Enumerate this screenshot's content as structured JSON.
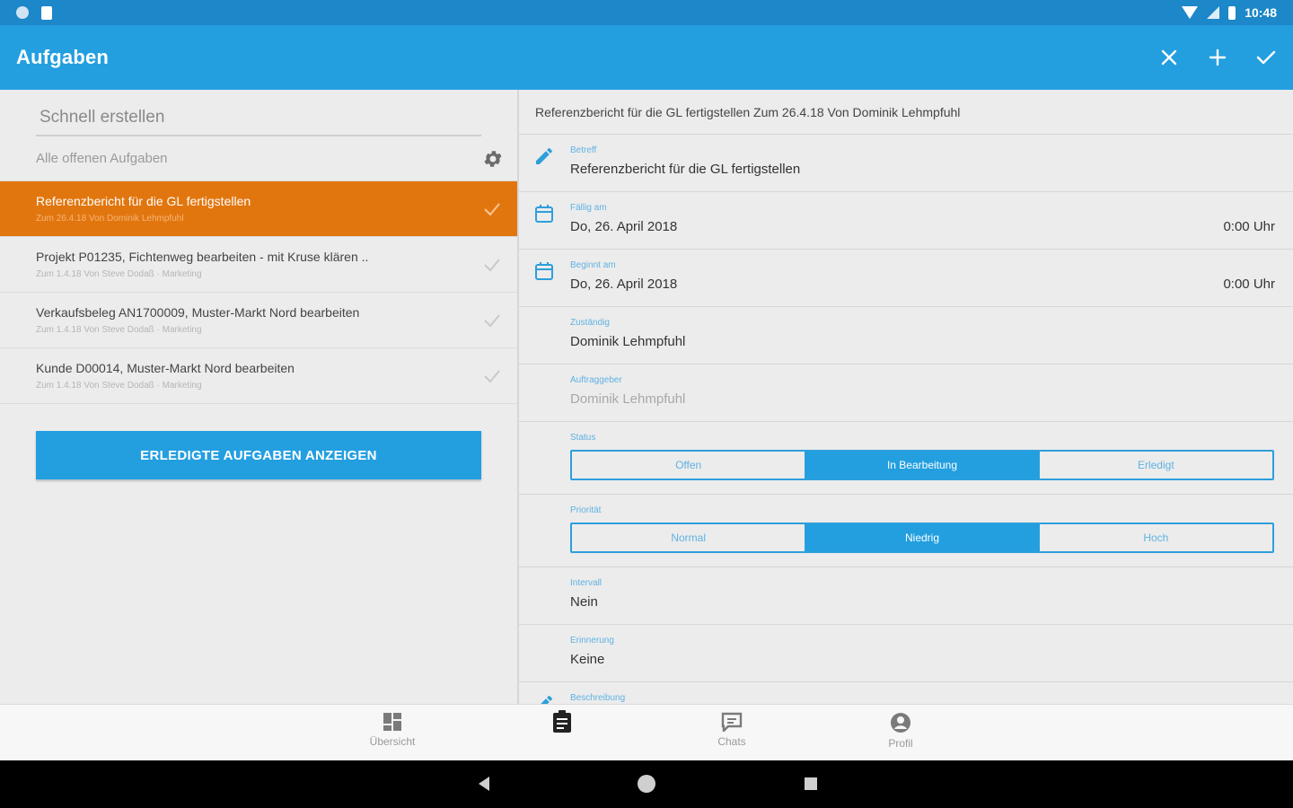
{
  "status_bar": {
    "time": "10:48"
  },
  "app_bar": {
    "title": "Aufgaben",
    "actions": [
      "close-icon",
      "add-icon",
      "check-icon"
    ]
  },
  "left": {
    "quick_create_placeholder": "Schnell erstellen",
    "filter_label": "Alle offenen Aufgaben",
    "tasks": [
      {
        "title": "Referenzbericht für die GL fertigstellen",
        "meta": "Zum 26.4.18 Von Dominik Lehmpfuhl",
        "active": true
      },
      {
        "title": "Projekt P01235, Fichtenweg bearbeiten - mit Kruse klären ..",
        "meta": "Zum 1.4.18 Von Steve Dodaß · Marketing",
        "active": false
      },
      {
        "title": "Verkaufsbeleg AN1700009, Muster-Markt Nord bearbeiten",
        "meta": "Zum 1.4.18 Von Steve Dodaß · Marketing",
        "active": false
      },
      {
        "title": "Kunde D00014, Muster-Markt Nord bearbeiten",
        "meta": "Zum 1.4.18 Von Steve Dodaß · Marketing",
        "active": false
      }
    ],
    "done_button": "ERLEDIGTE AUFGABEN ANZEIGEN"
  },
  "detail": {
    "header": "Referenzbericht für die GL fertigstellen   Zum 26.4.18 Von Dominik Lehmpfuhl",
    "betreff": {
      "label": "Betreff",
      "value": "Referenzbericht für die GL fertigstellen"
    },
    "faellig": {
      "label": "Fällig am",
      "date": "Do, 26. April 2018",
      "time": "0:00 Uhr"
    },
    "beginnt": {
      "label": "Beginnt am",
      "date": "Do, 26. April 2018",
      "time": "0:00 Uhr"
    },
    "zustaendig": {
      "label": "Zuständig",
      "value": "Dominik Lehmpfuhl"
    },
    "auftraggeber": {
      "label": "Auftraggeber",
      "value": "Dominik Lehmpfuhl"
    },
    "status": {
      "label": "Status",
      "options": [
        "Offen",
        "In Bearbeitung",
        "Erledigt"
      ],
      "selected": "In Bearbeitung"
    },
    "prioritaet": {
      "label": "Priorität",
      "options": [
        "Normal",
        "Niedrig",
        "Hoch"
      ],
      "selected": "Niedrig"
    },
    "intervall": {
      "label": "Intervall",
      "value": "Nein"
    },
    "erinnerung": {
      "label": "Erinnerung",
      "value": "Keine"
    },
    "beschreibung": {
      "label": "Beschreibung"
    }
  },
  "bottom_nav": [
    {
      "label": "Übersicht",
      "icon": "dashboard-icon"
    },
    {
      "label": "",
      "icon": "clipboard-icon"
    },
    {
      "label": "Chats",
      "icon": "chat-icon"
    },
    {
      "label": "Profil",
      "icon": "profile-icon"
    }
  ],
  "colors": {
    "primary": "#239fe0",
    "status_bar": "#1c87c9",
    "active_task": "#e2760e"
  }
}
